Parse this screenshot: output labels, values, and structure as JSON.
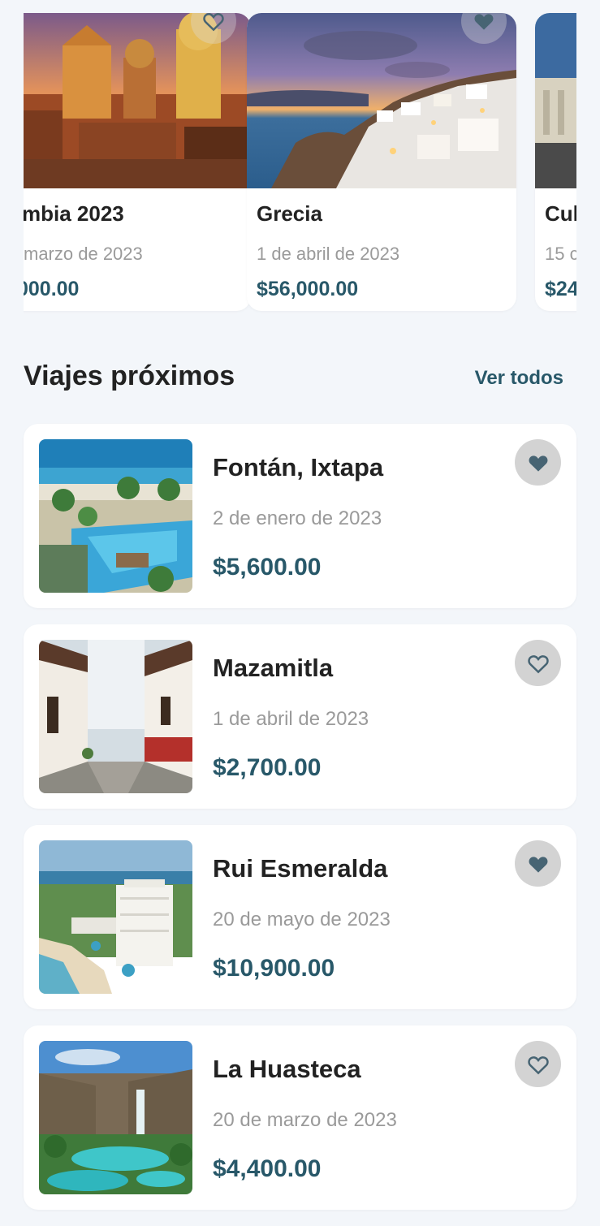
{
  "featured": [
    {
      "title": "mbia 2023",
      "date": "marzo de 2023",
      "price": "000.00",
      "favorite_icon": "heart-outline-icon"
    },
    {
      "title": "Grecia",
      "date": "1 de abril de 2023",
      "price": "$56,000.00",
      "favorite_icon": "heart-filled-icon"
    },
    {
      "title": "Cul",
      "date": "15 c",
      "price": "$24",
      "favorite_icon": ""
    }
  ],
  "section": {
    "title": "Viajes próximos",
    "see_all_label": "Ver todos"
  },
  "trips": [
    {
      "title": "Fontán, Ixtapa",
      "date": "2 de enero de 2023",
      "price": "$5,600.00",
      "favorite": true,
      "favorite_icon": "heart-filled-icon"
    },
    {
      "title": "Mazamitla",
      "date": "1 de abril de 2023",
      "price": "$2,700.00",
      "favorite": false,
      "favorite_icon": "heart-outline-icon"
    },
    {
      "title": "Rui Esmeralda",
      "date": "20 de mayo de 2023",
      "price": "$10,900.00",
      "favorite": true,
      "favorite_icon": "heart-filled-icon"
    },
    {
      "title": "La Huasteca",
      "date": "20 de marzo de 2023",
      "price": "$4,400.00",
      "favorite": false,
      "favorite_icon": "heart-outline-icon"
    }
  ],
  "colors": {
    "background": "#f3f6fa",
    "card": "#ffffff",
    "accent": "#285869",
    "muted_text": "#9a9a9a",
    "title_text": "#222222",
    "favorite_bg": "#d3d3d3",
    "heart": "#476473"
  }
}
